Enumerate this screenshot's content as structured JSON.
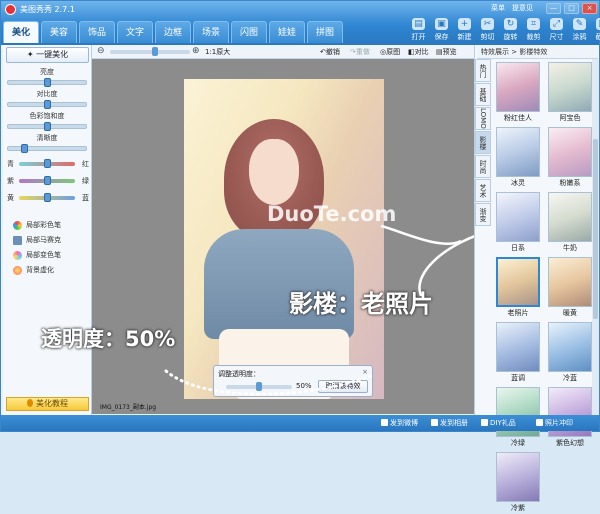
{
  "app": {
    "title": "美图秀秀 2.7.1"
  },
  "menu": {
    "items": [
      "菜单",
      "提意见"
    ]
  },
  "window": {
    "min": "—",
    "max": "□",
    "close": "×"
  },
  "tabs": [
    {
      "label": "美化",
      "active": true
    },
    {
      "label": "美容"
    },
    {
      "label": "饰品"
    },
    {
      "label": "文字"
    },
    {
      "label": "边框"
    },
    {
      "label": "场景"
    },
    {
      "label": "闪图"
    },
    {
      "label": "娃娃"
    },
    {
      "label": "拼图"
    }
  ],
  "toolbar": [
    {
      "label": "打开",
      "icon": "folder-icon"
    },
    {
      "label": "保存",
      "icon": "save-icon"
    },
    {
      "label": "新建",
      "icon": "new-icon"
    },
    {
      "label": "剪切",
      "icon": "cut-icon"
    },
    {
      "label": "旋转",
      "icon": "rotate-icon"
    },
    {
      "label": "裁剪",
      "icon": "crop-icon"
    },
    {
      "label": "尺寸",
      "icon": "resize-icon"
    },
    {
      "label": "涂鸦",
      "icon": "brush-icon"
    },
    {
      "label": "截屏",
      "icon": "screenshot-icon"
    }
  ],
  "left": {
    "onekey": "一键美化",
    "adjustments": [
      {
        "label": "亮度",
        "value": 0.5
      },
      {
        "label": "对比度",
        "value": 0.5
      },
      {
        "label": "色彩饱和度",
        "value": 0.5
      },
      {
        "label": "清晰度",
        "value": 0.18
      }
    ],
    "tints": [
      {
        "left": "青",
        "right": "红",
        "color": "#e06a6a",
        "value": 0.5
      },
      {
        "left": "紫",
        "right": "绿",
        "color": "#b575c8",
        "value": 0.5
      },
      {
        "left": "黄",
        "right": "蓝",
        "color": "#6e9fdd",
        "value": 0.5
      }
    ],
    "pens": [
      "局部彩色笔",
      "局部马赛克",
      "局部变色笔",
      "背景虚化"
    ],
    "tutorial": "美化教程"
  },
  "canvas_bar": {
    "zoom_text": "1:1原大",
    "undo": "撤销",
    "redo": "重做",
    "original": "原图",
    "compare": "对比",
    "preview": "预览"
  },
  "canvas": {
    "filename": "IMG_0173_副本.jpg",
    "watermark": "DuoTe.com"
  },
  "opacity_panel": {
    "title": "调整透明度：",
    "close": "×",
    "value_text": "50%",
    "value": 0.5,
    "cancel": "取消该特效"
  },
  "annotations": {
    "opacity": "透明度：50%",
    "studio": "影楼：老照片"
  },
  "right": {
    "breadcrumb": "特效展示 > 影楼特效",
    "vtabs": [
      {
        "label": "热门"
      },
      {
        "label": "基础"
      },
      {
        "label": "LOMO"
      },
      {
        "label": "影楼",
        "active": true
      },
      {
        "label": "时尚"
      },
      {
        "label": "艺术"
      },
      {
        "label": "渐变"
      }
    ],
    "thumbs": [
      {
        "label": "粉红佳人"
      },
      {
        "label": "阿宝色"
      },
      {
        "label": "冰灵"
      },
      {
        "label": "粉嫩系"
      },
      {
        "label": "日系"
      },
      {
        "label": "牛奶"
      },
      {
        "label": "老照片",
        "selected": true
      },
      {
        "label": "暖黄"
      },
      {
        "label": "蓝调"
      },
      {
        "label": "冷蓝"
      },
      {
        "label": "冷绿"
      },
      {
        "label": "紫色幻想"
      },
      {
        "label": "冷紫"
      }
    ]
  },
  "status": {
    "items": [
      "发到微博",
      "发到相册",
      "DIY礼品",
      "照片冲印"
    ]
  }
}
